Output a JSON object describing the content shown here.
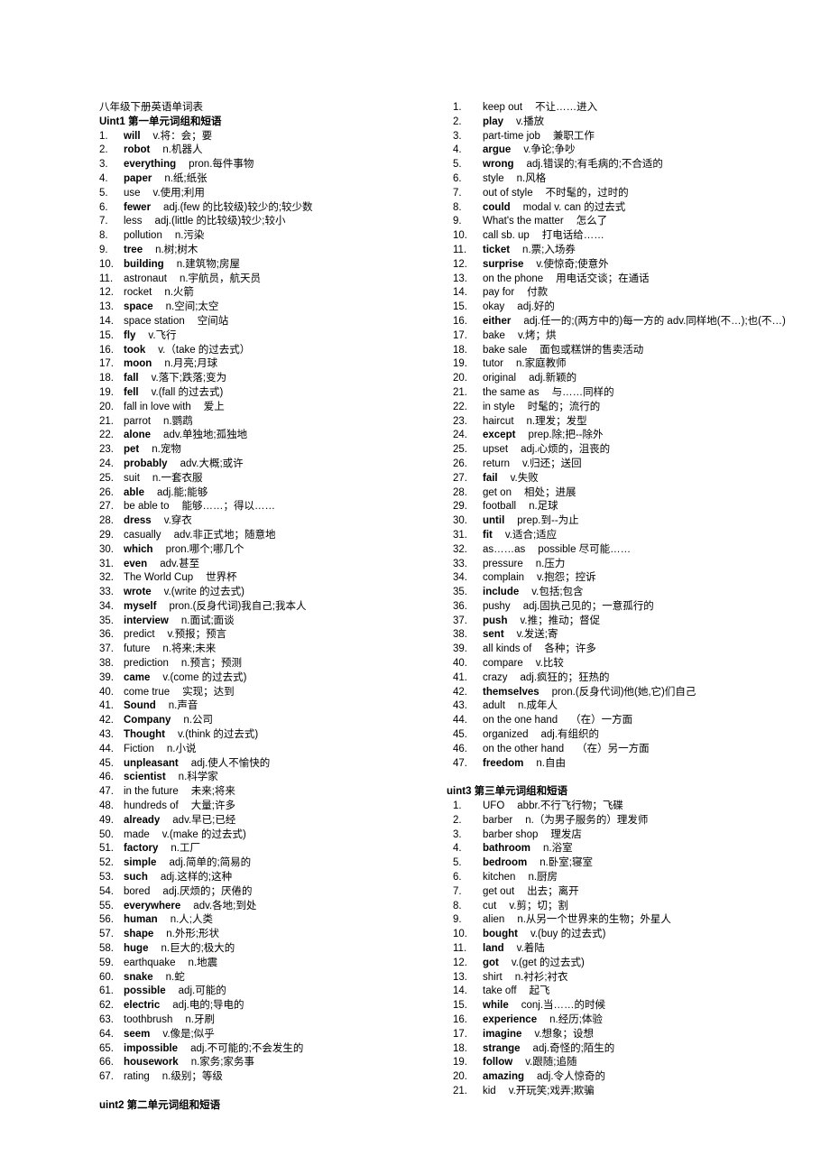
{
  "document": {
    "title": "八年级下册英语单词表"
  },
  "left_column": {
    "sections": [
      {
        "heading": "Uint1 第一单元词组和短语",
        "entries": [
          {
            "n": "1.",
            "term": "will",
            "bold": true,
            "def": "v.将：会；要"
          },
          {
            "n": "2.",
            "term": "robot",
            "bold": true,
            "def": "n.机器人"
          },
          {
            "n": "3.",
            "term": "everything",
            "bold": true,
            "def": "pron.每件事物"
          },
          {
            "n": "4.",
            "term": "paper",
            "bold": true,
            "def": "n.纸;纸张"
          },
          {
            "n": "5.",
            "term": "use",
            "bold": false,
            "def": "v.使用;利用"
          },
          {
            "n": "6.",
            "term": "fewer",
            "bold": true,
            "def": "adj.(few 的比较级)较少的;较少数"
          },
          {
            "n": "7.",
            "term": "less",
            "bold": false,
            "def": "adj.(little 的比较级)较少;较小"
          },
          {
            "n": "8.",
            "term": "pollution",
            "bold": false,
            "def": "n.污染"
          },
          {
            "n": "9.",
            "term": "tree",
            "bold": true,
            "def": "n.树;树木"
          },
          {
            "n": "10.",
            "term": "building",
            "bold": true,
            "def": "n.建筑物;房屋"
          },
          {
            "n": "11.",
            "term": "astronaut",
            "bold": false,
            "def": "n.宇航员，航天员"
          },
          {
            "n": "12.",
            "term": "rocket",
            "bold": false,
            "def": "n.火箭"
          },
          {
            "n": "13.",
            "term": "space",
            "bold": true,
            "def": "n.空间;太空"
          },
          {
            "n": "14.",
            "term": "space station",
            "bold": false,
            "def": "空间站"
          },
          {
            "n": "15.",
            "term": "fly",
            "bold": true,
            "def": "v.飞行"
          },
          {
            "n": "16.",
            "term": "took",
            "bold": true,
            "def": "v.（take 的过去式）"
          },
          {
            "n": "17.",
            "term": "moon",
            "bold": true,
            "def": "n.月亮;月球"
          },
          {
            "n": "18.",
            "term": "fall",
            "bold": true,
            "def": "v.落下;跌落;变为"
          },
          {
            "n": "19.",
            "term": "fell",
            "bold": true,
            "def": "v.(fall 的过去式)"
          },
          {
            "n": "20.",
            "term": "fall in love with",
            "bold": false,
            "def": "爱上"
          },
          {
            "n": "21.",
            "term": "parrot",
            "bold": false,
            "def": "n.鹦鹉"
          },
          {
            "n": "22.",
            "term": "alone",
            "bold": true,
            "def": "adv.单独地;孤独地"
          },
          {
            "n": "23.",
            "term": "pet",
            "bold": true,
            "def": "n.宠物"
          },
          {
            "n": "24.",
            "term": "probably",
            "bold": true,
            "def": "adv.大概;或许"
          },
          {
            "n": "25.",
            "term": "suit",
            "bold": false,
            "def": "n.一套衣服"
          },
          {
            "n": "26.",
            "term": "able",
            "bold": true,
            "def": "adj.能;能够"
          },
          {
            "n": "27.",
            "term": "be able to",
            "bold": false,
            "def": "能够……；得以……"
          },
          {
            "n": "28.",
            "term": "dress",
            "bold": true,
            "def": "v.穿衣"
          },
          {
            "n": "29.",
            "term": "casually",
            "bold": false,
            "def": "adv.非正式地；随意地"
          },
          {
            "n": "30.",
            "term": "which",
            "bold": true,
            "def": "pron.哪个;哪几个"
          },
          {
            "n": "31.",
            "term": "even",
            "bold": true,
            "def": "adv.甚至"
          },
          {
            "n": "32.",
            "term": "The World Cup",
            "bold": false,
            "def": "世界杯"
          },
          {
            "n": "33.",
            "term": "wrote",
            "bold": true,
            "def": "v.(write 的过去式)"
          },
          {
            "n": "34.",
            "term": "myself",
            "bold": true,
            "def": "pron.(反身代词)我自己;我本人"
          },
          {
            "n": "35.",
            "term": "interview",
            "bold": true,
            "def": "n.面试;面谈"
          },
          {
            "n": "36.",
            "term": "predict",
            "bold": false,
            "def": "v.预报；预言"
          },
          {
            "n": "37.",
            "term": "future",
            "bold": false,
            "def": "n.将来;未来"
          },
          {
            "n": "38.",
            "term": "prediction",
            "bold": false,
            "def": "n.预言；预测"
          },
          {
            "n": "39.",
            "term": "came",
            "bold": true,
            "def": "v.(come 的过去式)"
          },
          {
            "n": "40.",
            "term": "come true",
            "bold": false,
            "def": "实现；达到"
          },
          {
            "n": "41.",
            "term": "Sound",
            "bold": true,
            "def": "n.声音"
          },
          {
            "n": "42.",
            "term": "Company",
            "bold": true,
            "def": "n.公司"
          },
          {
            "n": "43.",
            "term": "Thought",
            "bold": true,
            "def": "v.(think 的过去式)"
          },
          {
            "n": "44.",
            "term": "Fiction",
            "bold": false,
            "def": "n.小说"
          },
          {
            "n": "45.",
            "term": "unpleasant",
            "bold": true,
            "def": "adj.使人不愉快的"
          },
          {
            "n": "46.",
            "term": "scientist",
            "bold": true,
            "def": "n.科学家"
          },
          {
            "n": "47.",
            "term": "in the future",
            "bold": false,
            "def": "未来;将来"
          },
          {
            "n": "48.",
            "term": "hundreds of",
            "bold": false,
            "def": "大量;许多"
          },
          {
            "n": "49.",
            "term": "already",
            "bold": true,
            "def": "adv.早已;已经"
          },
          {
            "n": "50.",
            "term": "made",
            "bold": false,
            "def": "v.(make 的过去式)"
          },
          {
            "n": "51.",
            "term": "factory",
            "bold": true,
            "def": "n.工厂"
          },
          {
            "n": "52.",
            "term": "simple",
            "bold": true,
            "def": "adj.简单的;简易的"
          },
          {
            "n": "53.",
            "term": "such",
            "bold": true,
            "def": "adj.这样的;这种"
          },
          {
            "n": "54.",
            "term": "bored",
            "bold": false,
            "def": "adj.厌烦的；厌倦的"
          },
          {
            "n": "55.",
            "term": "everywhere",
            "bold": true,
            "def": "adv.各地;到处"
          },
          {
            "n": "56.",
            "term": "human",
            "bold": true,
            "def": "n.人;人类"
          },
          {
            "n": "57.",
            "term": "shape",
            "bold": true,
            "def": "n.外形;形状"
          },
          {
            "n": "58.",
            "term": "huge",
            "bold": true,
            "def": "n.巨大的;极大的"
          },
          {
            "n": "59.",
            "term": "earthquake",
            "bold": false,
            "def": "n.地震"
          },
          {
            "n": "60.",
            "term": "snake",
            "bold": true,
            "def": "n.蛇"
          },
          {
            "n": "61.",
            "term": "possible",
            "bold": true,
            "def": "adj.可能的"
          },
          {
            "n": "62.",
            "term": "electric",
            "bold": true,
            "def": "adj.电的;导电的"
          },
          {
            "n": "63.",
            "term": "toothbrush",
            "bold": false,
            "def": "n.牙刷"
          },
          {
            "n": "64.",
            "term": "seem",
            "bold": true,
            "def": "v.像是;似乎"
          },
          {
            "n": "65.",
            "term": "impossible",
            "bold": true,
            "def": "adj.不可能的;不会发生的"
          },
          {
            "n": "66.",
            "term": "housework",
            "bold": true,
            "def": "n.家务;家务事"
          },
          {
            "n": "67.",
            "term": "rating",
            "bold": false,
            "def": "n.级别；等级"
          }
        ]
      },
      {
        "heading": "uint2 第二单元词组和短语",
        "entries": []
      }
    ]
  },
  "right_column": {
    "sections": [
      {
        "heading": "",
        "entries": [
          {
            "n": "1.",
            "term": "keep out",
            "bold": false,
            "def": "不让……进入"
          },
          {
            "n": "2.",
            "term": "play",
            "bold": true,
            "def": "v.播放"
          },
          {
            "n": "3.",
            "term": "part-time job",
            "bold": false,
            "def": "兼职工作"
          },
          {
            "n": "4.",
            "term": "argue",
            "bold": true,
            "def": "v.争论;争吵"
          },
          {
            "n": "5.",
            "term": "wrong",
            "bold": true,
            "def": "adj.错误的;有毛病的;不合适的"
          },
          {
            "n": "6.",
            "term": "style",
            "bold": false,
            "def": "n.风格"
          },
          {
            "n": "7.",
            "term": "out of style",
            "bold": false,
            "def": "不时髦的，过时的"
          },
          {
            "n": "8.",
            "term": "could",
            "bold": true,
            "def": "modal v. can 的过去式"
          },
          {
            "n": "9.",
            "term": "What's the matter",
            "bold": false,
            "def": "怎么了"
          },
          {
            "n": "10.",
            "term": "call sb. up",
            "bold": false,
            "def": "打电话给……"
          },
          {
            "n": "11.",
            "term": "ticket",
            "bold": true,
            "def": "n.票;入场券"
          },
          {
            "n": "12.",
            "term": "surprise",
            "bold": true,
            "def": "v.使惊奇;使意外"
          },
          {
            "n": "13.",
            "term": "on the phone",
            "bold": false,
            "def": "用电话交谈；在通话"
          },
          {
            "n": "14.",
            "term": "pay for",
            "bold": false,
            "def": "付款"
          },
          {
            "n": "15.",
            "term": "okay",
            "bold": false,
            "def": "adj.好的"
          },
          {
            "n": "16.",
            "term": "either",
            "bold": true,
            "def": "adj.任一的;(两方中的)每一方的   adv.同样地(不…);也(不…)"
          },
          {
            "n": "17.",
            "term": "bake",
            "bold": false,
            "def": "v.烤；烘"
          },
          {
            "n": "18.",
            "term": "bake sale",
            "bold": false,
            "def": "面包或糕饼的售卖活动"
          },
          {
            "n": "19.",
            "term": "tutor",
            "bold": false,
            "def": "n.家庭教师"
          },
          {
            "n": "20.",
            "term": "original",
            "bold": false,
            "def": "adj.新颖的"
          },
          {
            "n": "21.",
            "term": "the same as",
            "bold": false,
            "def": "与……同样的"
          },
          {
            "n": "22.",
            "term": "in style",
            "bold": false,
            "def": "时髦的；流行的"
          },
          {
            "n": "23.",
            "term": "haircut",
            "bold": false,
            "def": "n.理发；发型"
          },
          {
            "n": "24.",
            "term": "except",
            "bold": true,
            "def": "prep.除;把--除外"
          },
          {
            "n": "25.",
            "term": "upset",
            "bold": false,
            "def": "adj.心烦的，沮丧的"
          },
          {
            "n": "26.",
            "term": "return",
            "bold": false,
            "def": "v.归还；送回"
          },
          {
            "n": "27.",
            "term": "fail",
            "bold": true,
            "def": "v.失败"
          },
          {
            "n": "28.",
            "term": "get on",
            "bold": false,
            "def": "相处；进展"
          },
          {
            "n": "29.",
            "term": "football",
            "bold": false,
            "def": "n.足球"
          },
          {
            "n": "30.",
            "term": "until",
            "bold": true,
            "def": "prep.到--为止"
          },
          {
            "n": "31.",
            "term": "fit",
            "bold": true,
            "def": "v.适合;适应"
          },
          {
            "n": "32.",
            "term": "as……as",
            "bold": false,
            "def": "possible 尽可能……"
          },
          {
            "n": "33.",
            "term": "pressure",
            "bold": false,
            "def": "n.压力"
          },
          {
            "n": "34.",
            "term": "complain",
            "bold": false,
            "def": "v.抱怨；控诉"
          },
          {
            "n": "35.",
            "term": "include",
            "bold": true,
            "def": "v.包括;包含"
          },
          {
            "n": "36.",
            "term": "pushy",
            "bold": false,
            "def": "adj.固执己见的；一意孤行的"
          },
          {
            "n": "37.",
            "term": "push",
            "bold": true,
            "def": "v.推；推动；督促"
          },
          {
            "n": "38.",
            "term": "sent",
            "bold": true,
            "def": "v.发送;寄"
          },
          {
            "n": "39.",
            "term": "all kinds of",
            "bold": false,
            "def": "各种；许多"
          },
          {
            "n": "40.",
            "term": "compare",
            "bold": false,
            "def": "v.比较"
          },
          {
            "n": "41.",
            "term": "crazy",
            "bold": false,
            "def": "adj.疯狂的；狂热的"
          },
          {
            "n": "42.",
            "term": "themselves",
            "bold": true,
            "def": "pron.(反身代词)他(她,它)们自己"
          },
          {
            "n": "43.",
            "term": "adult",
            "bold": false,
            "def": "n.成年人"
          },
          {
            "n": "44.",
            "term": "on the one hand",
            "bold": false,
            "def": "（在）一方面"
          },
          {
            "n": "45.",
            "term": "organized",
            "bold": false,
            "def": "adj.有组织的"
          },
          {
            "n": "46.",
            "term": "on the other hand",
            "bold": false,
            "def": "（在）另一方面"
          },
          {
            "n": "47.",
            "term": "freedom",
            "bold": true,
            "def": "n.自由"
          }
        ]
      },
      {
        "heading": "uint3 第三单元词组和短语",
        "entries": [
          {
            "n": "1.",
            "term": "UFO",
            "bold": false,
            "def": "abbr.不行飞行物；飞碟"
          },
          {
            "n": "2.",
            "term": "barber",
            "bold": false,
            "def": "n.（为男子服务的）理发师"
          },
          {
            "n": "3.",
            "term": "barber shop",
            "bold": false,
            "def": "理发店"
          },
          {
            "n": "4.",
            "term": "bathroom",
            "bold": true,
            "def": "n.浴室"
          },
          {
            "n": "5.",
            "term": "bedroom",
            "bold": true,
            "def": "n.卧室;寝室"
          },
          {
            "n": "6.",
            "term": "kitchen",
            "bold": false,
            "def": "n.厨房"
          },
          {
            "n": "7.",
            "term": "get out",
            "bold": false,
            "def": "出去；离开"
          },
          {
            "n": "8.",
            "term": "cut",
            "bold": false,
            "def": "v.剪；切；割"
          },
          {
            "n": "9.",
            "term": "alien",
            "bold": false,
            "def": "n.从另一个世界来的生物；外星人"
          },
          {
            "n": "10.",
            "term": "bought",
            "bold": true,
            "def": "v.(buy 的过去式)"
          },
          {
            "n": "11.",
            "term": "land",
            "bold": true,
            "def": "v.着陆"
          },
          {
            "n": "12.",
            "term": "got",
            "bold": true,
            "def": "v.(get 的过去式)"
          },
          {
            "n": "13.",
            "term": "shirt",
            "bold": false,
            "def": "n.衬衫;衬衣"
          },
          {
            "n": "14.",
            "term": "take off",
            "bold": false,
            "def": "起飞"
          },
          {
            "n": "15.",
            "term": "while",
            "bold": true,
            "def": "conj.当……的时候"
          },
          {
            "n": "16.",
            "term": "experience",
            "bold": true,
            "def": "n.经历;体验"
          },
          {
            "n": "17.",
            "term": "imagine",
            "bold": true,
            "def": "v.想象；设想"
          },
          {
            "n": "18.",
            "term": "strange",
            "bold": true,
            "def": "adj.奇怪的;陌生的"
          },
          {
            "n": "19.",
            "term": "follow",
            "bold": true,
            "def": "v.跟随;追随"
          },
          {
            "n": "20.",
            "term": "amazing",
            "bold": true,
            "def": "adj.令人惊奇的"
          },
          {
            "n": "21.",
            "term": "kid",
            "bold": false,
            "def": "v.开玩笑;戏弄;欺骗"
          }
        ]
      }
    ]
  }
}
